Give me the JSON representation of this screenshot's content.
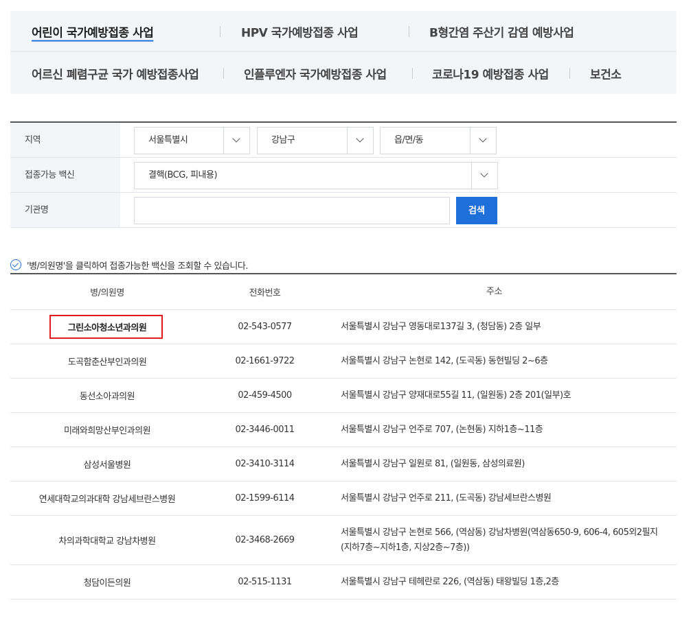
{
  "tabs": {
    "row1": [
      {
        "label": "어린이 국가예방접종 사업",
        "active": true
      },
      {
        "label": "HPV 국가예방접종 사업"
      },
      {
        "label": "B형간염 주산기 감염 예방사업"
      }
    ],
    "row2": [
      {
        "label": "어르신 폐렴구균 국가 예방접종사업"
      },
      {
        "label": "인플루엔자 국가예방접종 사업"
      },
      {
        "label": "코로나19 예방접종 사업"
      },
      {
        "label": "보건소"
      }
    ]
  },
  "search": {
    "region_label": "지역",
    "region_city": "서울특별시",
    "region_district": "강남구",
    "region_town": "읍/면/동",
    "vaccine_label": "접종가능 백신",
    "vaccine_value": "결핵(BCG, 피내용)",
    "org_label": "기관명",
    "org_value": "",
    "search_button": "검색"
  },
  "notice": "'병/의원명'을 클릭하여 접종가능한 백신을 조회할 수 있습니다.",
  "results": {
    "headers": {
      "name": "병/의원명",
      "phone": "전화번호",
      "address": "주소"
    },
    "rows": [
      {
        "name": "그린소아청소년과의원",
        "phone": "02-543-0577",
        "address": "서울특별시 강남구 영동대로137길 3, (청담동) 2층 일부"
      },
      {
        "name": "도곡함춘산부인과의원",
        "phone": "02-1661-9722",
        "address": "서울특별시 강남구 논현로 142, (도곡동) 동현빌딩 2~6층"
      },
      {
        "name": "동선소아과의원",
        "phone": "02-459-4500",
        "address": "서울특별시 강남구 양재대로55길 11, (일원동) 2층 201(일부)호"
      },
      {
        "name": "미래와희망산부인과의원",
        "phone": "02-3446-0011",
        "address": "서울특별시 강남구 언주로 707, (논현동) 지하1층~11층"
      },
      {
        "name": "삼성서울병원",
        "phone": "02-3410-3114",
        "address": "서울특별시 강남구 일원로 81, (일원동, 삼성의료원)"
      },
      {
        "name": "연세대학교의과대학 강남세브란스병원",
        "phone": "02-1599-6114",
        "address": "서울특별시 강남구 언주로 211, (도곡동) 강남세브란스병원"
      },
      {
        "name": "차의과학대학교 강남차병원",
        "phone": "02-3468-2669",
        "address": "서울특별시 강남구 논현로 566, (역삼동) 강남차병원(역삼동650-9, 606-4, 605외2필지(지하7층~지하1층, 지상2층~7층))"
      },
      {
        "name": "청담이든의원",
        "phone": "02-515-1131",
        "address": "서울특별시 강남구 테헤란로 226, (역삼동) 태왕빌딩 1층,2층"
      }
    ]
  },
  "colors": {
    "accent": "#1e6fd9",
    "highlight": "#e21c1c",
    "panel": "#f4f5f7"
  }
}
